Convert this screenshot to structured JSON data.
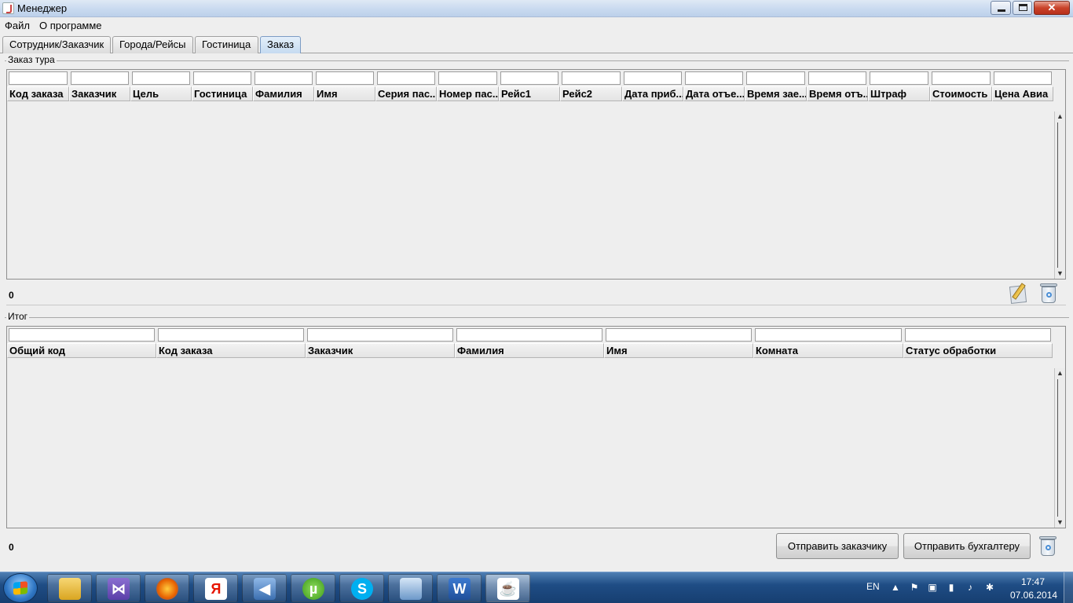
{
  "window": {
    "title": "Менеджер",
    "minimize": "_",
    "maximize": "□",
    "close": "✕"
  },
  "menu": [
    "Файл",
    "О программе"
  ],
  "tabs": [
    "Сотрудник/Заказчик",
    "Города/Рейсы",
    "Гостиница",
    "Заказ"
  ],
  "active_tab": "Заказ",
  "orders": {
    "title": "Заказ тура",
    "columns": [
      "Код заказа",
      "Заказчик",
      "Цель",
      "Гостиница",
      "Фамилия",
      "Имя",
      "Серия пас...",
      "Номер пас...",
      "Рейс1",
      "Рейс2",
      "Дата приб...",
      "Дата отъе...",
      "Время зае...",
      "Время отъ...",
      "Штраф",
      "Стоимость",
      "Цена Авиа"
    ],
    "filters": [
      "",
      "",
      "",
      "",
      "",
      "",
      "",
      "",
      "",
      "",
      "",
      "",
      "",
      "",
      "",
      "",
      ""
    ],
    "rows": [],
    "count": "0",
    "icons": [
      "edit-icon",
      "trash-icon"
    ]
  },
  "summary": {
    "title": "Итог",
    "columns": [
      "Общий код",
      "Код заказа",
      "Заказчик",
      "Фамилия",
      "Имя",
      "Комната",
      "Статус обработки"
    ],
    "filters": [
      "",
      "",
      "",
      "",
      "",
      "",
      ""
    ],
    "rows": [],
    "count": "0",
    "send_customer_label": "Отправить заказчику",
    "send_accountant_label": "Отправить бухгалтеру",
    "icons": [
      "trash-icon"
    ]
  },
  "taskbar": {
    "apps": [
      "explorer-icon",
      "visual-studio-icon",
      "firefox-icon",
      "yandex-icon",
      "audio-icon",
      "utorrent-icon",
      "skype-icon",
      "virtualbox-icon",
      "word-icon",
      "java-icon"
    ],
    "active_app": "java-icon",
    "lang": "EN",
    "time": "17:47",
    "date": "07.06.2014"
  }
}
